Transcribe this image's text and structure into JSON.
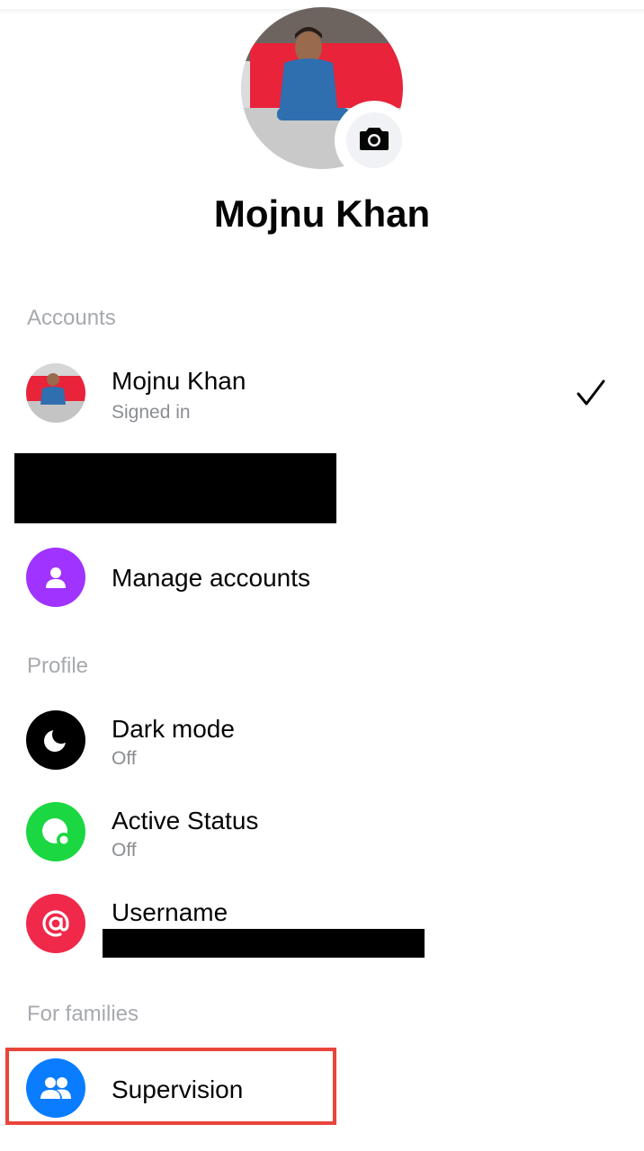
{
  "profile": {
    "name": "Mojnu Khan",
    "avatar_icon": "profile-photo",
    "camera_icon": "camera-icon"
  },
  "accounts": {
    "header": "Accounts",
    "current": {
      "name": "Mojnu Khan",
      "status": "Signed in",
      "check_icon": "checkmark-icon"
    },
    "manage": {
      "label": "Manage accounts",
      "icon": "person-icon",
      "color": "#a033ff"
    }
  },
  "profile_section": {
    "header": "Profile",
    "items": [
      {
        "label": "Dark mode",
        "value": "Off",
        "icon": "moon-icon",
        "color": "#000000"
      },
      {
        "label": "Active Status",
        "value": "Off",
        "icon": "active-status-icon",
        "color": "#1bd741"
      },
      {
        "label": "Username",
        "icon": "at-icon",
        "color": "#f0284a"
      }
    ]
  },
  "families": {
    "header": "For families",
    "supervision": {
      "label": "Supervision",
      "icon": "people-icon",
      "color": "#0a7cff"
    }
  },
  "colors": {
    "highlight": "#e8453c",
    "section_header": "#a6a9ae",
    "secondary_text": "#8a8d91"
  }
}
